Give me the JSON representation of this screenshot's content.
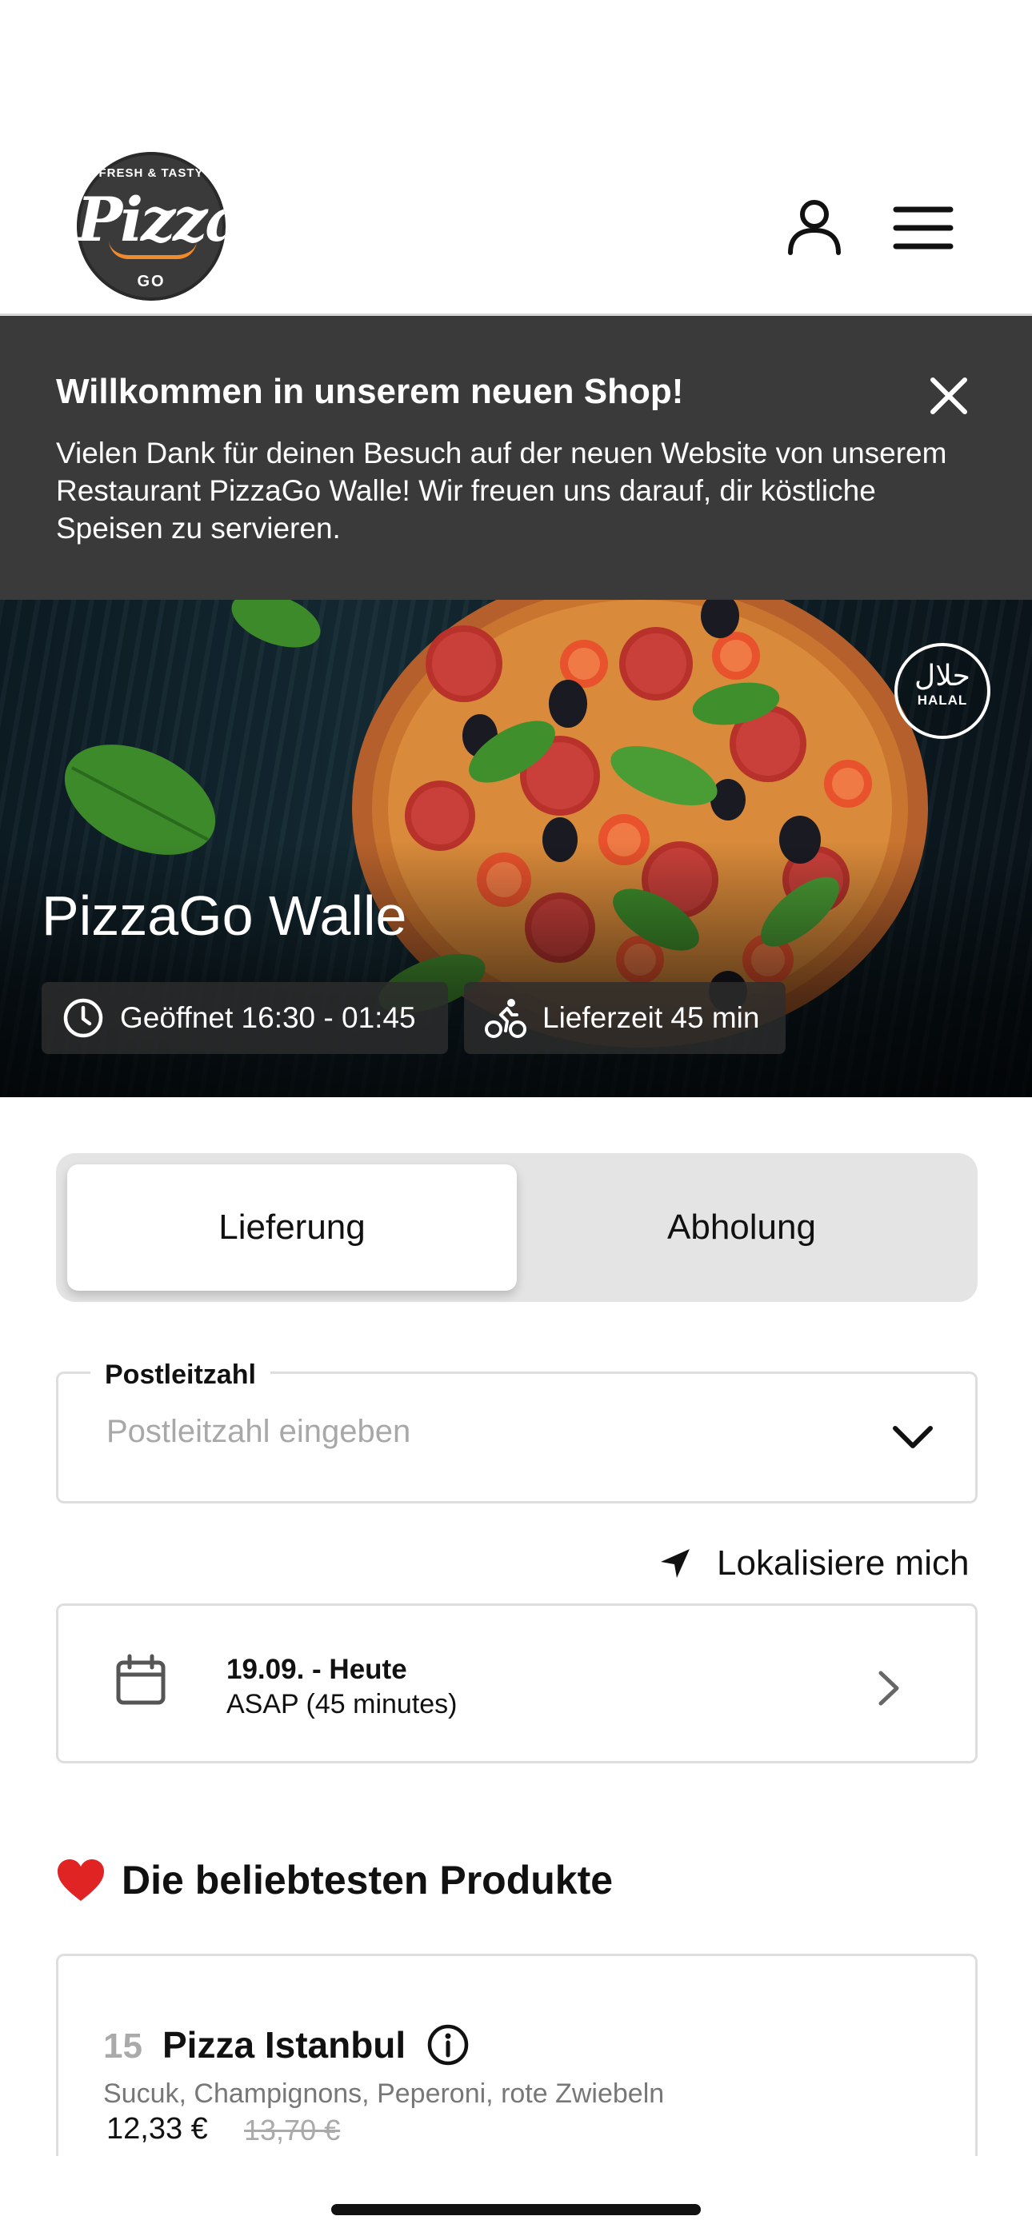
{
  "header": {
    "logo": {
      "top_text": "FRESH & TASTY",
      "script_text": "Pizza",
      "bottom_text": "GO"
    },
    "icons": {
      "account": "user-icon",
      "menu": "hamburger-menu-icon"
    }
  },
  "banner": {
    "title": "Willkommen in unserem neuen Shop!",
    "text": "Vielen Dank für deinen Besuch auf der neuen Website von unserem Restaurant PizzaGo Walle! Wir freuen uns darauf, dir köstliche Speisen zu servieren.",
    "close_icon": "close-icon"
  },
  "hero": {
    "restaurant_name": "PizzaGo Walle",
    "halal_arabic": "حلال",
    "halal_latin": "HALAL",
    "opening_hours": "Geöffnet 16:30 - 01:45",
    "delivery_time": "Lieferzeit 45 min"
  },
  "order_mode": {
    "options": [
      "Lieferung",
      "Abholung"
    ],
    "selected": "Lieferung"
  },
  "postcode": {
    "label": "Postleitzahl",
    "placeholder": "Postleitzahl eingeben",
    "value": ""
  },
  "locate_label": "Lokalisiere mich",
  "schedule": {
    "date": "19.09. - Heute",
    "time": "ASAP (45 minutes)"
  },
  "popular": {
    "title": "Die beliebtesten Produkte",
    "products": [
      {
        "number": "15",
        "name": "Pizza Istanbul",
        "description": "Sucuk, Champignons, Peperoni, rote Zwiebeln",
        "price": "12,33 €",
        "old_price": "13,70 €"
      }
    ]
  },
  "colors": {
    "banner_bg": "#3a3a3a",
    "toggle_bg": "#e4e4e4",
    "border": "#dedede",
    "logo_accent": "#f08a2a",
    "heart": "#e02424"
  }
}
